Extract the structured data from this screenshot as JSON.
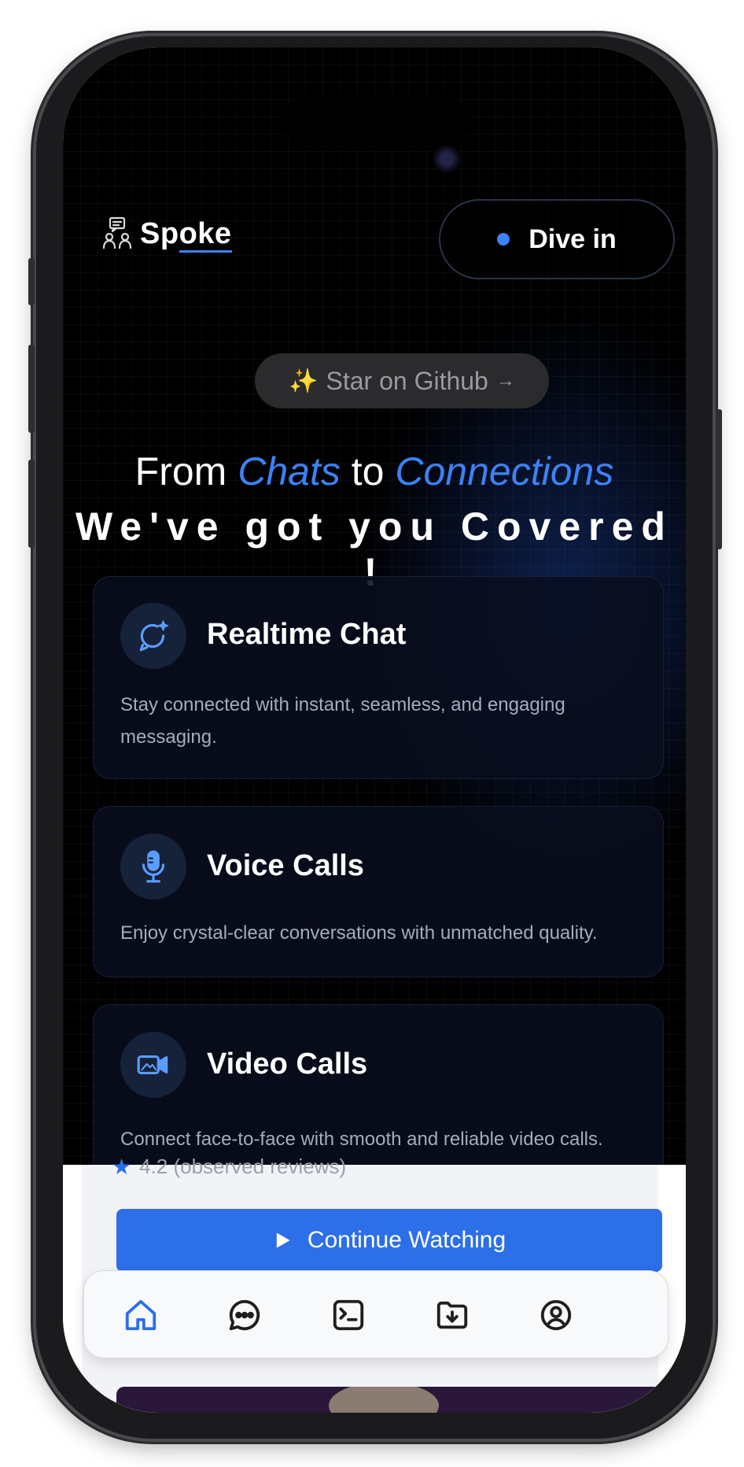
{
  "brand": {
    "name_start": "Sp",
    "name_underlined": "oke"
  },
  "header": {
    "cta_label": "Dive in"
  },
  "github": {
    "spark": "✨",
    "label": "Star on Github",
    "arrow": "→"
  },
  "hero": {
    "from": "From",
    "chats": "Chats",
    "to": "to",
    "connections": "Connections",
    "line2": "We've got you Covered !"
  },
  "features": [
    {
      "title": "Realtime Chat",
      "description": "Stay connected with instant, seamless, and engaging messaging.",
      "icon": "chat-sparkle-icon"
    },
    {
      "title": "Voice Calls",
      "description": "Enjoy crystal-clear conversations with unmatched quality.",
      "icon": "microphone-icon"
    },
    {
      "title": "Video Calls",
      "description": "Connect face-to-face with smooth and reliable video calls.",
      "icon": "video-icon"
    }
  ],
  "media": {
    "rating_text": "4.2 (observed reviews)",
    "continue_label": "Continue Watching"
  },
  "nav": {
    "items": [
      "home",
      "messages",
      "terminal",
      "downloads",
      "profile"
    ],
    "active": "home"
  },
  "colors": {
    "accent": "#3b82f6",
    "button": "#2d6fe8",
    "background": "#000000"
  }
}
